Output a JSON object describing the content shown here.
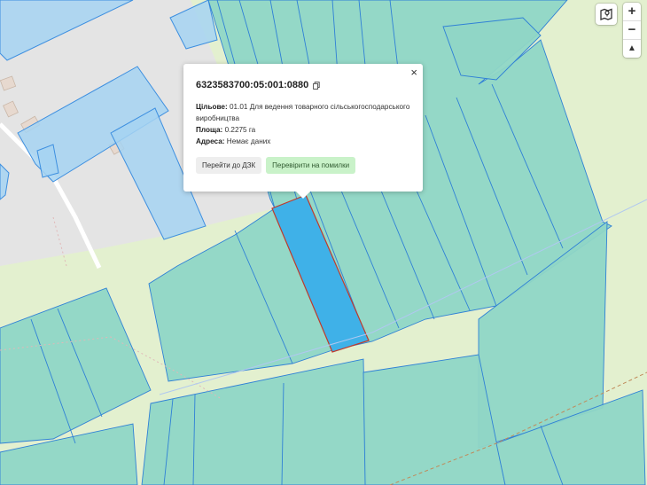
{
  "popup": {
    "cadastral_number": "6323583700:05:001:0880",
    "purpose_label": "Цільове:",
    "purpose_value": "01.01 Для ведення товарного сільськогосподарського виробництва",
    "area_label": "Площа:",
    "area_value": "0.2275 га",
    "address_label": "Адреса:",
    "address_value": "Немає даних",
    "go_to_dzk_label": "Перейти до ДЗК",
    "check_errors_label": "Перевірити на помилки",
    "close_label": "×"
  },
  "controls": {
    "zoom_in_label": "+",
    "zoom_out_label": "−",
    "compass_label": "▲"
  },
  "icons": {
    "layers": "map-layers-icon",
    "copy": "copy-icon",
    "close": "close-icon",
    "compass": "compass-icon"
  },
  "colors": {
    "background_field": "#e3f0cf",
    "urban_gray": "#e2e2e2",
    "parcel_teal": "#8fd6c6",
    "parcel_blue": "#a6d3f2",
    "selected_parcel": "#3fb1e8",
    "selected_outline": "#c0392b",
    "parcel_stroke": "#2f80d6"
  }
}
